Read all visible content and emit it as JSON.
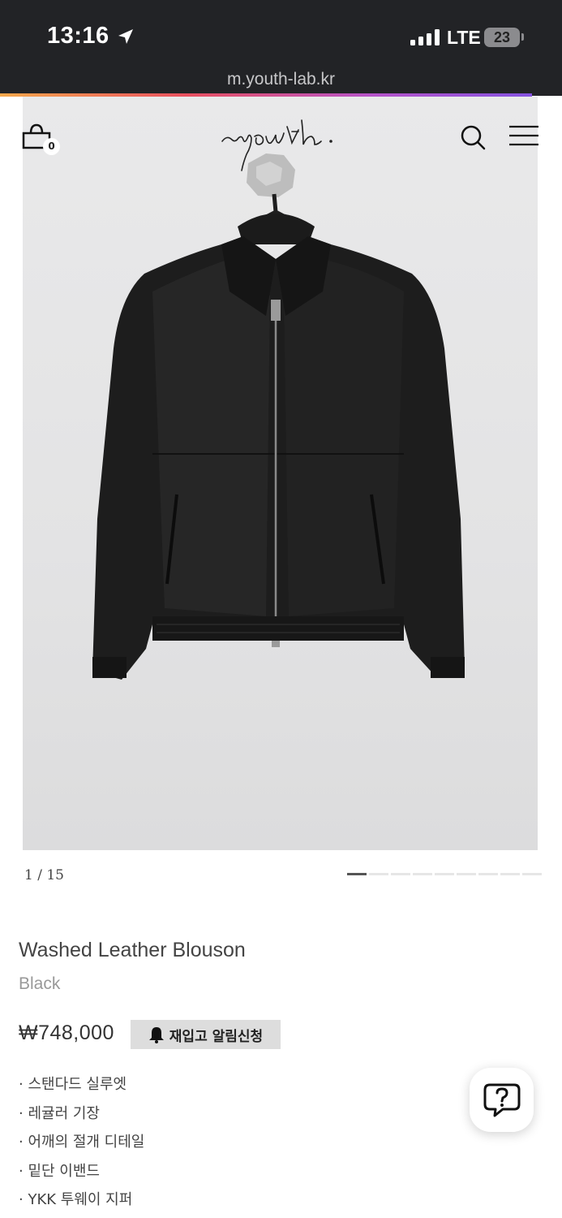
{
  "status_bar": {
    "time": "13:16",
    "network": "LTE",
    "battery": "23"
  },
  "browser": {
    "url": "m.youth-lab.kr"
  },
  "header": {
    "logo_text": "youth.",
    "cart_count": "0",
    "icons": [
      "bag-icon",
      "search-icon",
      "menu-icon"
    ]
  },
  "gallery": {
    "counter": "1 / 15",
    "total_slides": 9,
    "active_slide": 0
  },
  "product": {
    "title": "Washed Leather Blouson",
    "color": "Black",
    "price": "₩748,000",
    "restock_label": "재입고 알림신청",
    "features": [
      "· 스탠다드 실루엣",
      "· 레귤러 기장",
      "· 어깨의 절개 디테일",
      "· 밑단 이밴드",
      "· YKK 투웨이 지퍼"
    ]
  },
  "colors": {
    "status_bar_bg": "#222326",
    "restock_bg": "#dddddd"
  }
}
